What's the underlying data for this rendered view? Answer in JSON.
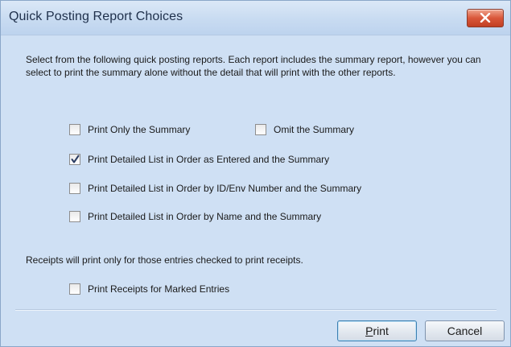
{
  "window": {
    "title": "Quick Posting Report Choices"
  },
  "intro_text": "Select from the following quick posting reports. Each report includes the summary report, however you can select to print the summary alone without the detail that will print with the other reports.",
  "options": {
    "print_only_summary": {
      "label": "Print Only the Summary",
      "checked": false
    },
    "omit_summary": {
      "label": "Omit the Summary",
      "checked": false
    },
    "order_entered": {
      "label": "Print Detailed List in Order as Entered and the Summary",
      "checked": true
    },
    "order_id": {
      "label": "Print Detailed List in Order by ID/Env Number and the Summary",
      "checked": false
    },
    "order_name": {
      "label": "Print Detailed List in Order by Name and the Summary",
      "checked": false
    }
  },
  "receipts": {
    "note": "Receipts will print only for those entries checked to print receipts.",
    "option": {
      "label": "Print Receipts for Marked Entries",
      "checked": false
    }
  },
  "buttons": {
    "print_mnemonic": "P",
    "print_rest": "rint",
    "cancel": "Cancel"
  },
  "colors": {
    "dialog_bg": "#cfe0f4",
    "close_button": "#d9573a"
  }
}
